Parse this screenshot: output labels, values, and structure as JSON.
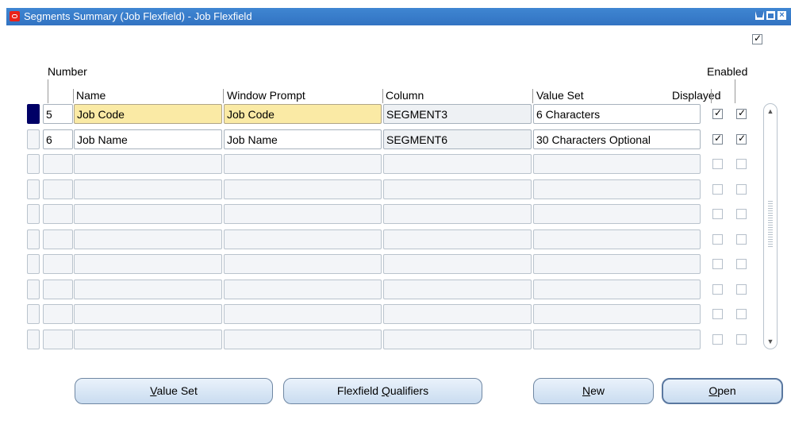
{
  "window": {
    "title": "Segments Summary (Job Flexfield) - Job Flexfield",
    "top_checkbox_checked": true
  },
  "columns": {
    "number": "Number",
    "name": "Name",
    "window_prompt": "Window Prompt",
    "column": "Column",
    "value_set": "Value Set",
    "displayed": "Displayed",
    "enabled": "Enabled"
  },
  "rows": [
    {
      "number": "5",
      "name": "Job Code",
      "window_prompt": "Job Code",
      "column": "SEGMENT3",
      "value_set": "6 Characters",
      "displayed": true,
      "enabled": true
    },
    {
      "number": "6",
      "name": "Job Name",
      "window_prompt": "Job Name",
      "column": "SEGMENT6",
      "value_set": "30 Characters Optional",
      "displayed": true,
      "enabled": true
    },
    {
      "number": "",
      "name": "",
      "window_prompt": "",
      "column": "",
      "value_set": "",
      "displayed": false,
      "enabled": false
    },
    {
      "number": "",
      "name": "",
      "window_prompt": "",
      "column": "",
      "value_set": "",
      "displayed": false,
      "enabled": false
    },
    {
      "number": "",
      "name": "",
      "window_prompt": "",
      "column": "",
      "value_set": "",
      "displayed": false,
      "enabled": false
    },
    {
      "number": "",
      "name": "",
      "window_prompt": "",
      "column": "",
      "value_set": "",
      "displayed": false,
      "enabled": false
    },
    {
      "number": "",
      "name": "",
      "window_prompt": "",
      "column": "",
      "value_set": "",
      "displayed": false,
      "enabled": false
    },
    {
      "number": "",
      "name": "",
      "window_prompt": "",
      "column": "",
      "value_set": "",
      "displayed": false,
      "enabled": false
    },
    {
      "number": "",
      "name": "",
      "window_prompt": "",
      "column": "",
      "value_set": "",
      "displayed": false,
      "enabled": false
    },
    {
      "number": "",
      "name": "",
      "window_prompt": "",
      "column": "",
      "value_set": "",
      "displayed": false,
      "enabled": false
    }
  ],
  "buttons": {
    "value_set": {
      "label": "Value Set",
      "mnemonic": "V"
    },
    "flexfield_qualifiers": {
      "label": "Flexfield Qualifiers",
      "mnemonic": "Q"
    },
    "new": {
      "label": "New",
      "mnemonic": "N"
    },
    "open": {
      "label": "Open",
      "mnemonic": "O"
    }
  },
  "colors": {
    "titlebar": "#3a7bc8",
    "required_field": "#faeaa5",
    "selected_row": "#000066"
  }
}
